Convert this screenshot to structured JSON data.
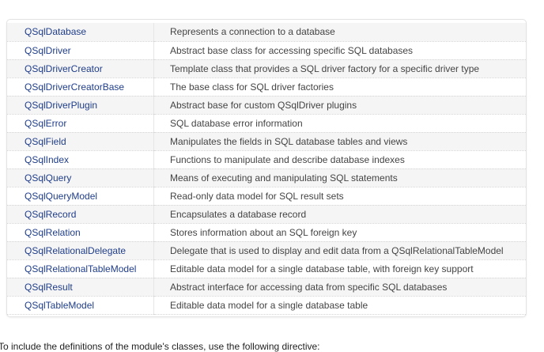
{
  "classes": [
    {
      "name": "QSqlDatabase",
      "description": "Represents a connection to a database"
    },
    {
      "name": "QSqlDriver",
      "description": "Abstract base class for accessing specific SQL databases"
    },
    {
      "name": "QSqlDriverCreator",
      "description": "Template class that provides a SQL driver factory for a specific driver type"
    },
    {
      "name": "QSqlDriverCreatorBase",
      "description": "The base class for SQL driver factories"
    },
    {
      "name": "QSqlDriverPlugin",
      "description": "Abstract base for custom QSqlDriver plugins"
    },
    {
      "name": "QSqlError",
      "description": "SQL database error information"
    },
    {
      "name": "QSqlField",
      "description": "Manipulates the fields in SQL database tables and views"
    },
    {
      "name": "QSqlIndex",
      "description": "Functions to manipulate and describe database indexes"
    },
    {
      "name": "QSqlQuery",
      "description": "Means of executing and manipulating SQL statements"
    },
    {
      "name": "QSqlQueryModel",
      "description": "Read-only data model for SQL result sets"
    },
    {
      "name": "QSqlRecord",
      "description": "Encapsulates a database record"
    },
    {
      "name": "QSqlRelation",
      "description": "Stores information about an SQL foreign key"
    },
    {
      "name": "QSqlRelationalDelegate",
      "description": "Delegate that is used to display and edit data from a QSqlRelationalTableModel"
    },
    {
      "name": "QSqlRelationalTableModel",
      "description": "Editable data model for a single database table, with foreign key support"
    },
    {
      "name": "QSqlResult",
      "description": "Abstract interface for accessing data from specific SQL databases"
    },
    {
      "name": "QSqlTableModel",
      "description": "Editable data model for a single database table"
    }
  ],
  "footer_text": "To include the definitions of the module's classes, use the following directive:",
  "colors": {
    "link": "#1f3d8a",
    "row_alt": "#f5f5f5"
  }
}
